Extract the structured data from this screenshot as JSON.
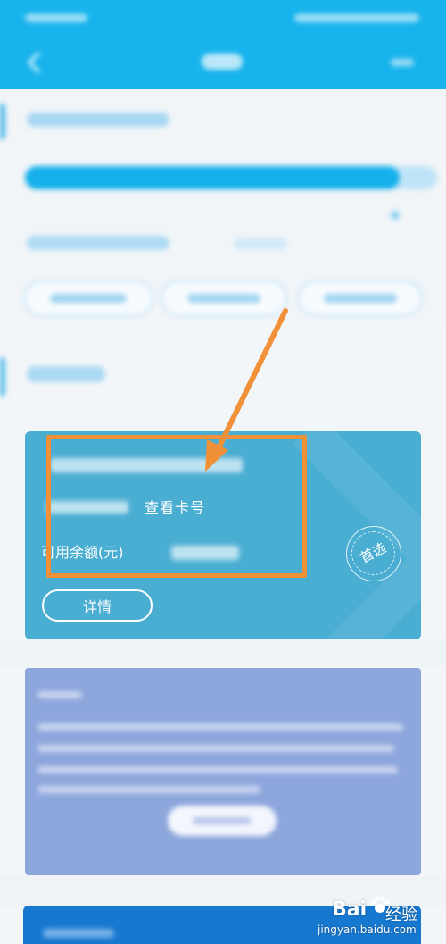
{
  "account_card": {
    "view_card_number_label": "查看卡号",
    "available_balance_label": "可用余额(元)",
    "preferred_badge": "首选",
    "details_button": "详情"
  },
  "watermark": {
    "logo_text": "Bai",
    "logo_suffix": "经验",
    "url": "jingyan.baidu.com"
  },
  "colors": {
    "header": "#17b3ec",
    "account_card": "#4aaed3",
    "highlight": "#f0913a",
    "purple_card": "#8da6dc",
    "blue_card": "#1778cf"
  },
  "icons": {
    "back": "back-chevron-icon",
    "preferred": "preferred-stamp-icon",
    "arrow": "annotation-arrow"
  }
}
